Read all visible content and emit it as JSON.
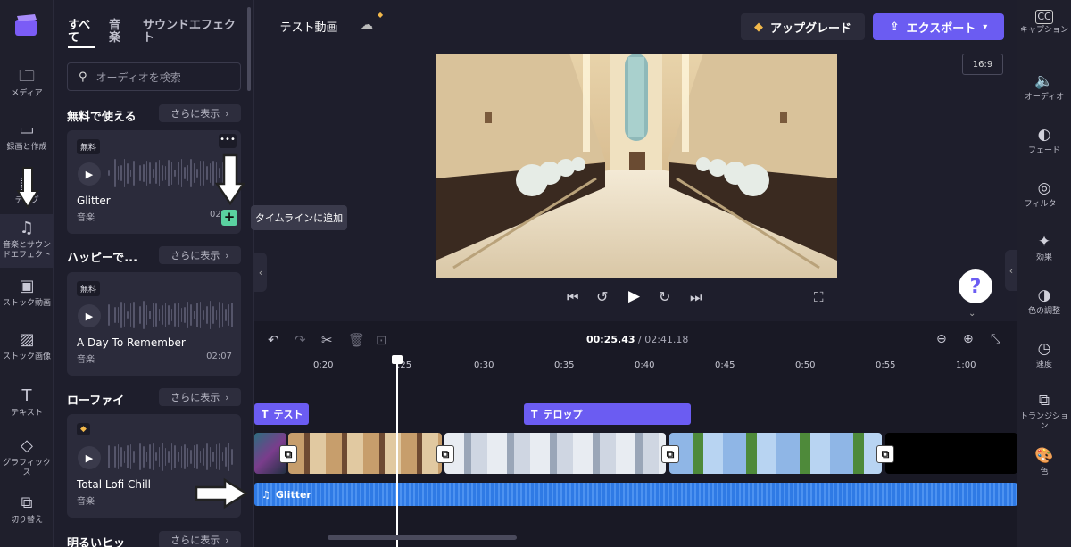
{
  "app": {
    "logo": "clipchamp-logo",
    "project_name": "テスト動画",
    "aspect_ratio": "16:9"
  },
  "leftnav": [
    {
      "icon": "folder-icon",
      "label": "メディア"
    },
    {
      "icon": "camera-icon",
      "label": "録画と作成"
    },
    {
      "icon": "text-icon",
      "label": "テンプ"
    },
    {
      "icon": "music-icon",
      "label": "音楽とサウンドエフェクト"
    },
    {
      "icon": "film-icon",
      "label": "ストック動画"
    },
    {
      "icon": "image-icon",
      "label": "ストック画像"
    },
    {
      "icon": "text-T-icon",
      "label": "テキスト"
    },
    {
      "icon": "shapes-icon",
      "label": "グラフィックス"
    },
    {
      "icon": "transition-icon",
      "label": "切り替え"
    }
  ],
  "panel": {
    "tabs": [
      "すべて",
      "音楽",
      "サウンドエフェクト"
    ],
    "search_placeholder": "オーディオを検索",
    "sections": [
      {
        "title": "無料で使える",
        "more": "さらに表示",
        "card": {
          "badge": "無料",
          "title": "Glitter",
          "sub": "音楽",
          "duration": "02"
        }
      },
      {
        "title": "ハッピーで...",
        "more": "さらに表示",
        "card": {
          "badge": "無料",
          "title": "A Day To Remember",
          "sub": "音楽",
          "duration": "02:07"
        }
      },
      {
        "title": "ローファイ",
        "more": "さらに表示",
        "card": {
          "badge": "premium-diamond",
          "title": "Total Lofi Chill",
          "sub": "音楽",
          "duration": ""
        }
      },
      {
        "title": "明るいヒッ",
        "more": "さらに表示"
      }
    ],
    "tooltip": "タイムラインに追加"
  },
  "topbar": {
    "upgrade": "アップグレード",
    "export": "エクスポート"
  },
  "player": {
    "help": "?"
  },
  "rightnav": [
    {
      "icon": "cc-icon",
      "label": "キャプション"
    },
    {
      "icon": "speaker-icon",
      "label": "オーディオ"
    },
    {
      "icon": "fade-icon",
      "label": "フェード"
    },
    {
      "icon": "filter-icon",
      "label": "フィルター"
    },
    {
      "icon": "magic-wand-icon",
      "label": "効果"
    },
    {
      "icon": "color-adjust-icon",
      "label": "色の調整"
    },
    {
      "icon": "speed-icon",
      "label": "速度"
    },
    {
      "icon": "transition-icon",
      "label": "トランジション"
    },
    {
      "icon": "palette-icon",
      "label": "色"
    }
  ],
  "timeline": {
    "current_time": "00:25.43",
    "total_time": "/ 02:41.18",
    "ticks": [
      "0:20",
      ":25",
      "0:30",
      "0:35",
      "0:40",
      "0:45",
      "0:50",
      "0:55",
      "1:00"
    ],
    "text_clips": [
      "テスト",
      "テロップ"
    ],
    "audio_clip": "Glitter"
  },
  "colors": {
    "accent": "#6b5cf2",
    "add_green": "#5ad1a0",
    "audio": "#2f7ae5"
  }
}
